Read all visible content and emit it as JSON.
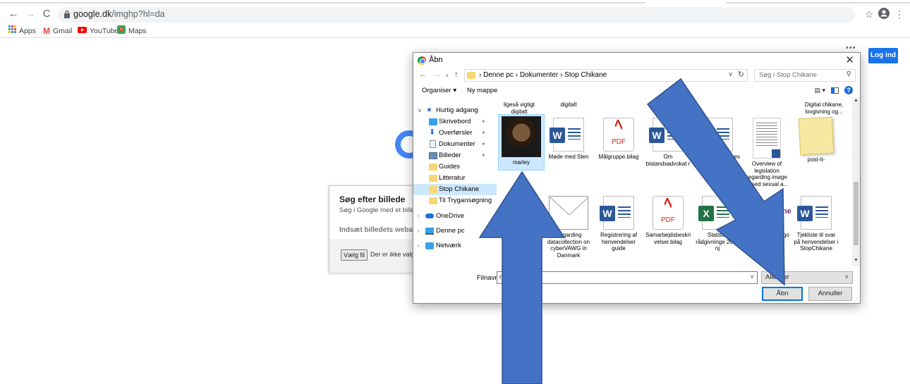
{
  "browser": {
    "url_host": "google.dk",
    "url_path": "/imghp?hl=da",
    "bookmarks": [
      {
        "label": "Apps",
        "icon": "apps-grid-icon"
      },
      {
        "label": "Gmail",
        "icon": "gmail-icon"
      },
      {
        "label": "YouTube",
        "icon": "youtube-icon"
      },
      {
        "label": "Maps",
        "icon": "maps-icon"
      }
    ]
  },
  "google": {
    "login_label": "Log ind",
    "search_by_image": {
      "title": "Søg efter billede",
      "subtitle": "Søg i Google med et billede",
      "paste_label": "Indsæt billedets weba",
      "choose_file_label": "Vælg fil",
      "no_file_text": "Der er ikke valg"
    }
  },
  "dialog": {
    "title": "Åbn",
    "breadcrumb": [
      "Denne pc",
      "Dokumenter",
      "Stop Chikane"
    ],
    "search_placeholder": "Søg i Stop Chikane",
    "organize_label": "Organiser ▾",
    "new_folder_label": "Ny mappe",
    "nav_items": [
      {
        "label": "Hurtig adgang",
        "icon": "star-icon",
        "level": 0,
        "expandable": true
      },
      {
        "label": "Skrivebord",
        "icon": "desktop-icon",
        "level": 1,
        "pinned": true
      },
      {
        "label": "Overførsler",
        "icon": "download-icon",
        "level": 1,
        "pinned": true
      },
      {
        "label": "Dokumenter",
        "icon": "documents-icon",
        "level": 1,
        "pinned": true
      },
      {
        "label": "Billeder",
        "icon": "pictures-icon",
        "level": 1,
        "pinned": true
      },
      {
        "label": "Guides",
        "icon": "folder-icon",
        "level": 1
      },
      {
        "label": "Litteratur",
        "icon": "folder-icon",
        "level": 1
      },
      {
        "label": "Stop Chikane",
        "icon": "folder-icon",
        "level": 1,
        "selected": true
      },
      {
        "label": "Til Trygansøgning",
        "icon": "folder-icon",
        "level": 1
      },
      {
        "label": "OneDrive",
        "icon": "onedrive-icon",
        "level": 0,
        "expandable": true
      },
      {
        "label": "Denne pc",
        "icon": "pc-icon",
        "level": 0,
        "expandable": true
      },
      {
        "label": "Netværk",
        "icon": "network-icon",
        "level": 0,
        "expandable": true
      }
    ],
    "files_partial_top": [
      "ligeså vigtigt digitalt",
      "digitalt",
      "Digital chikane, lovgivning og..."
    ],
    "files": [
      {
        "name": "marley",
        "kind": "image",
        "selected": true
      },
      {
        "name": "Møde med Sten",
        "kind": "word"
      },
      {
        "name": "Målgruppe.bilag",
        "kind": "pdf"
      },
      {
        "name": "Om bistandsadvokat r",
        "kind": "word"
      },
      {
        "name": "oces",
        "kind": "word"
      },
      {
        "name": "Overview of legislation regarding image based sexual a...",
        "kind": "doc-preview"
      },
      {
        "name": "post-it-",
        "kind": "note"
      },
      {
        "name": "p",
        "kind": "file"
      },
      {
        "name": "Regarding datacollection on cyberVAWG in Danmark",
        "kind": "mail"
      },
      {
        "name": "Registrering af henvendelser guide",
        "kind": "word"
      },
      {
        "name": "Samarbejdsbeskri velser.bilag",
        "kind": "pdf"
      },
      {
        "name": "Statistik rådgivninge 2020 nj",
        "kind": "excel"
      },
      {
        "name": "topC logo",
        "kind": "logo"
      },
      {
        "name": "Tjekliste til svar på henvendelser i StopChikane",
        "kind": "word"
      }
    ],
    "logo_text": "Chikane",
    "filename_label": "Filnavn:",
    "filename_value": "m",
    "filetype_value": "Alle filer",
    "open_label": "Åbn",
    "cancel_label": "Annuller"
  }
}
